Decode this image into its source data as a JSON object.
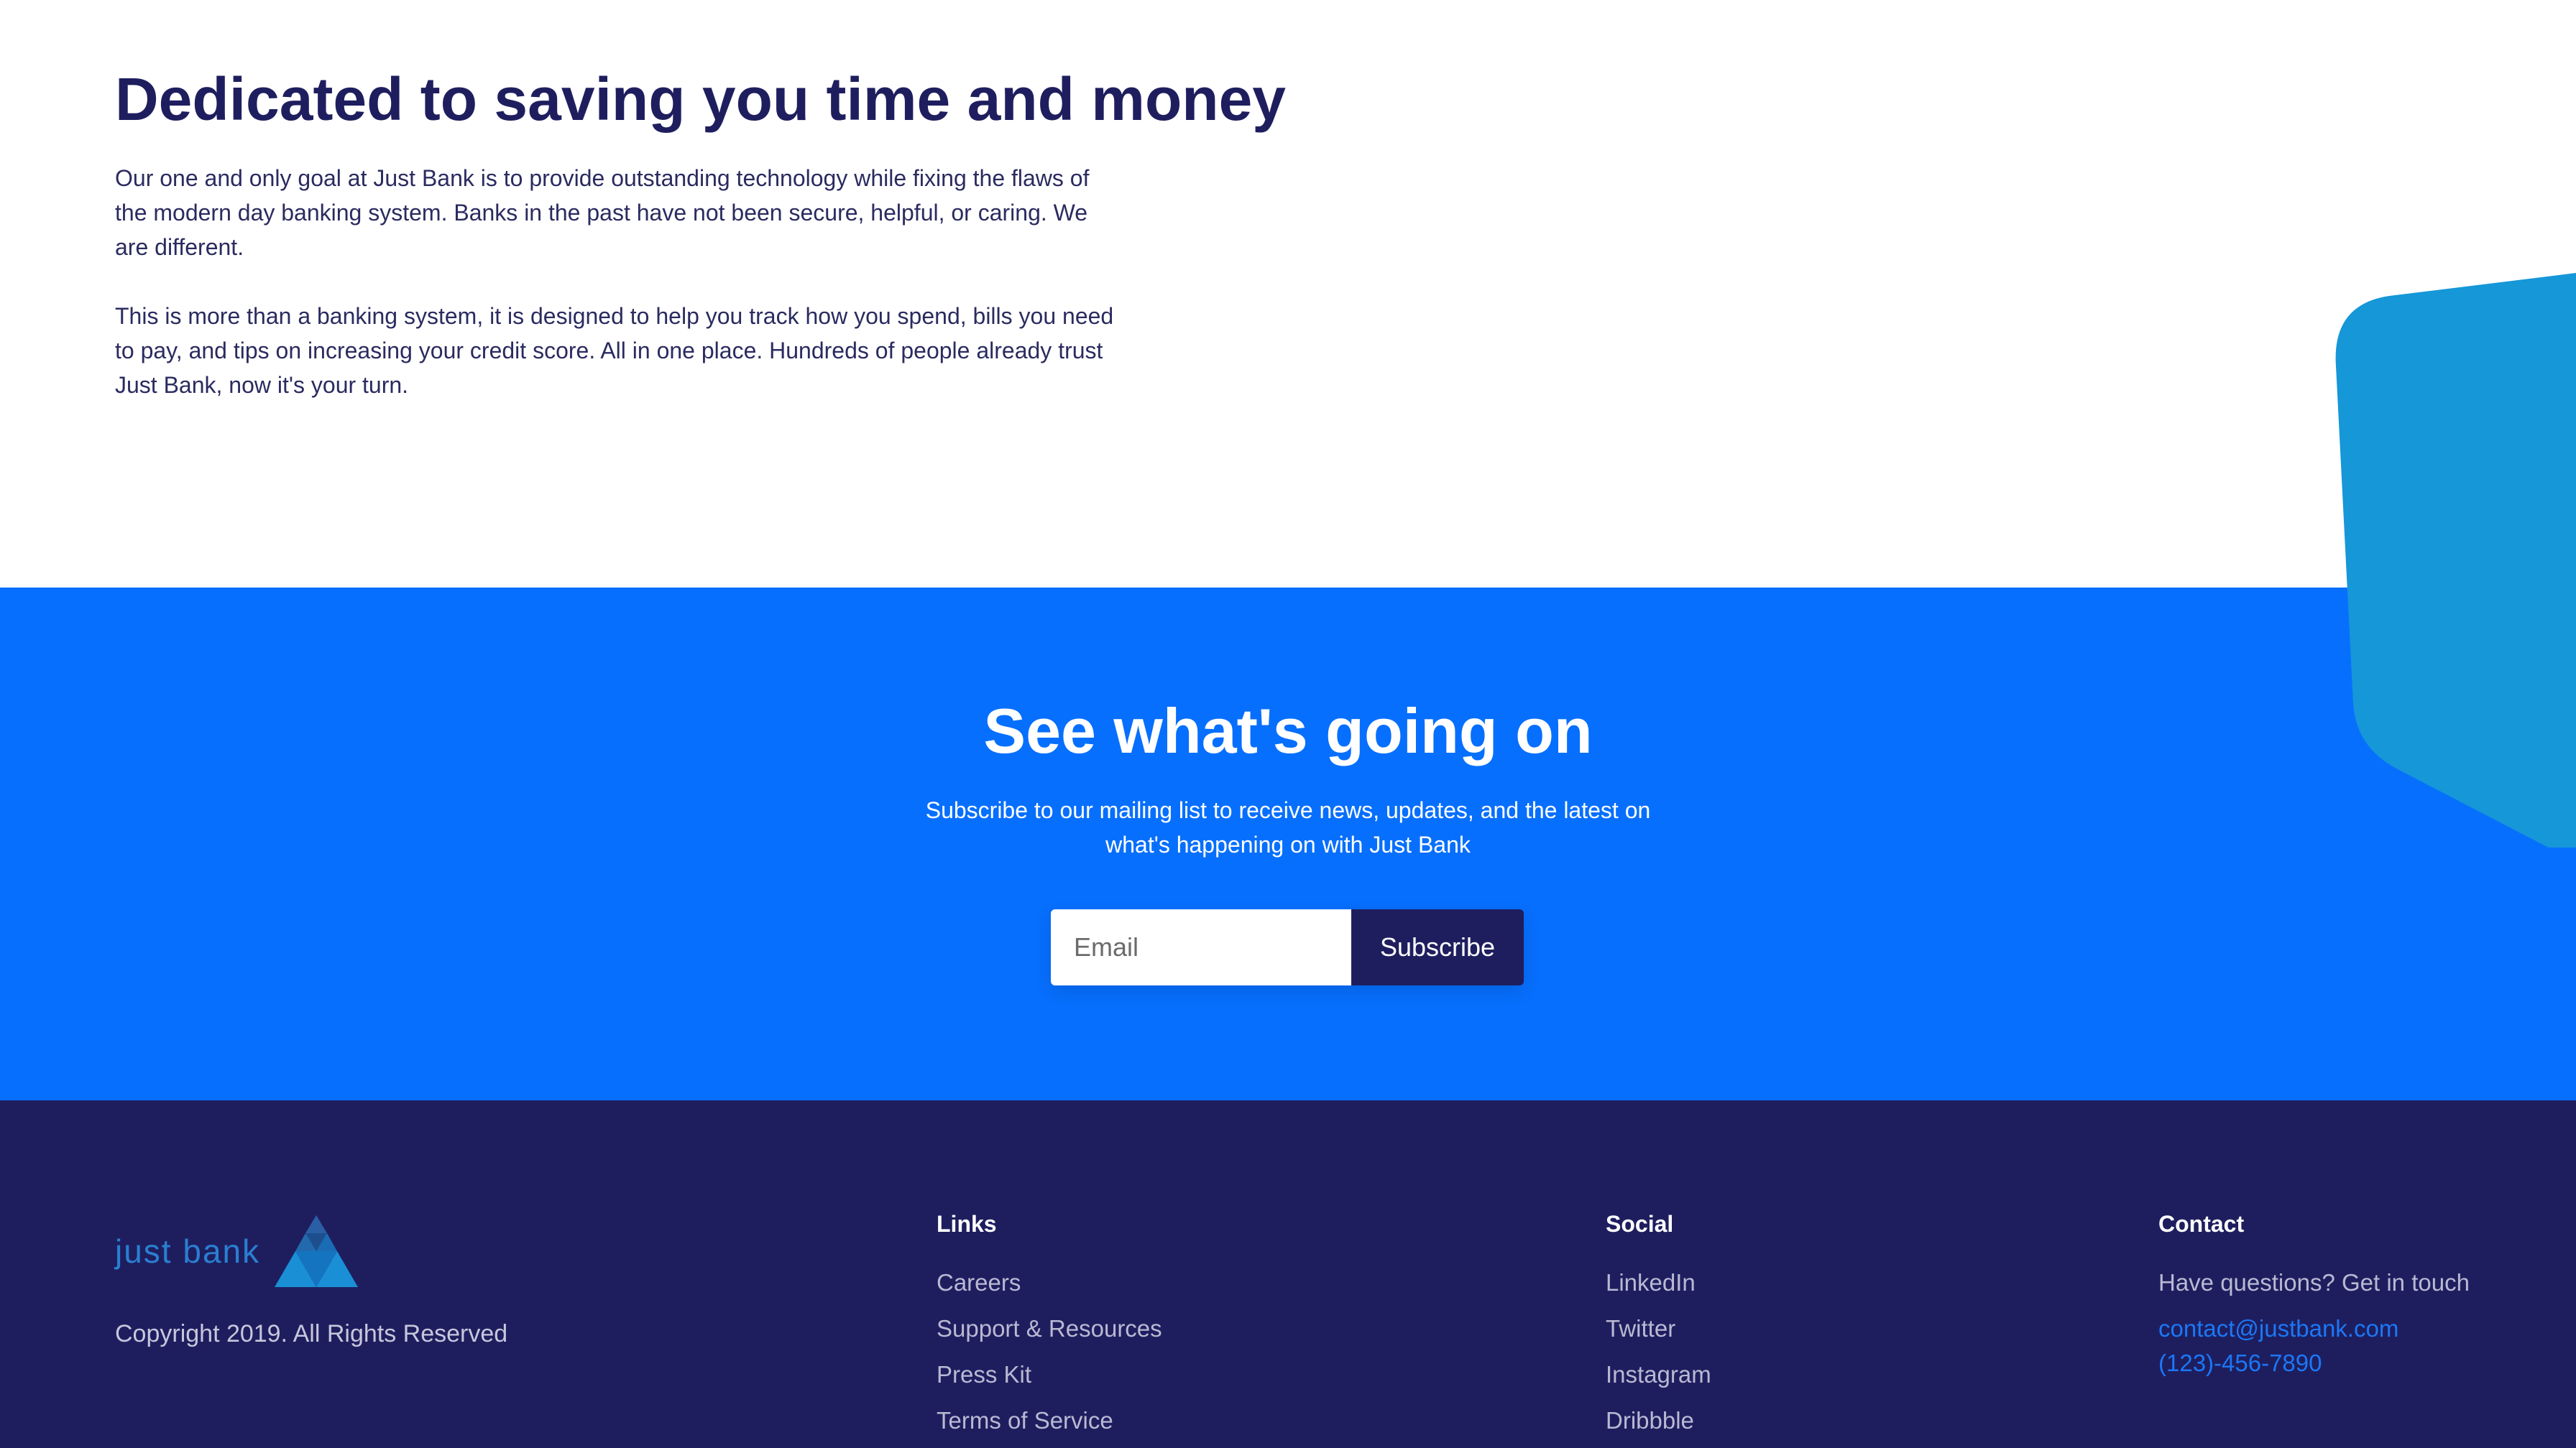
{
  "about": {
    "title": "Dedicated to saving you time and money",
    "paragraph1": "Our one and only goal at Just Bank is to provide outstanding technology while fixing the flaws of the modern day banking system. Banks in the past have not been secure, helpful, or caring. We are different.",
    "paragraph2": "This is more than a banking system, it is designed to help you track how you spend, bills you need to pay, and tips on increasing your credit score. All in one place. Hundreds of people already trust Just Bank, now it's your turn."
  },
  "newsletter": {
    "title": "See what's going on",
    "subtitle": "Subscribe to our mailing list to receive news, updates, and the latest on what's happening on with Just Bank",
    "email_placeholder": "Email",
    "subscribe_label": "Subscribe"
  },
  "footer": {
    "logo_text": "just bank",
    "copyright": "Copyright 2019. All Rights Reserved",
    "links": {
      "heading": "Links",
      "items": [
        "Careers",
        "Support & Resources",
        "Press Kit",
        "Terms of Service"
      ]
    },
    "social": {
      "heading": "Social",
      "items": [
        "LinkedIn",
        "Twitter",
        "Instagram",
        "Dribbble"
      ]
    },
    "contact": {
      "heading": "Contact",
      "prompt": "Have questions? Get in touch",
      "email": "contact@justbank.com",
      "phone": "(123)-456-7890"
    }
  },
  "colors": {
    "navy": "#1e1e5f",
    "blue": "#076ffd",
    "accent_shape": "#1597d8",
    "link_blue": "#1c77f5"
  }
}
